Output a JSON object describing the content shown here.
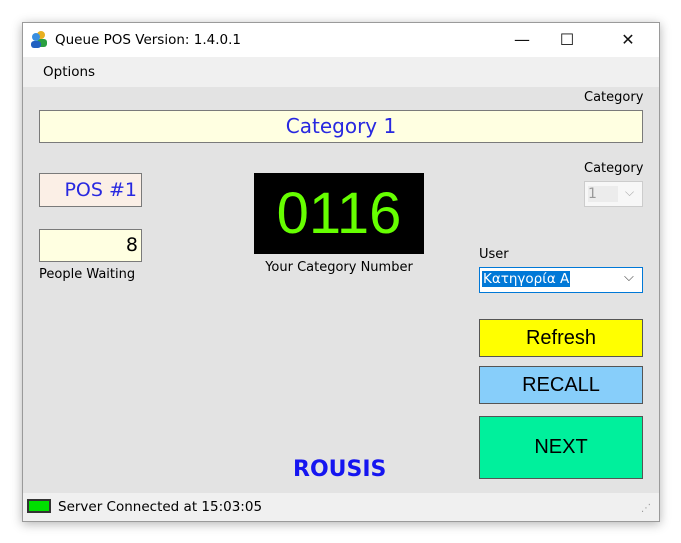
{
  "window": {
    "title": "Queue POS  Version: 1.4.0.1",
    "minimize": "—",
    "maximize": "☐",
    "close": "✕"
  },
  "menu": {
    "options": "Options"
  },
  "category_label": "Category",
  "category_banner": "Category 1",
  "pos_label": "POS #1",
  "people_waiting": {
    "value": "8",
    "label": "People Waiting"
  },
  "display": {
    "number": "0116",
    "label": "Your Category Number"
  },
  "category_select": {
    "label": "Category",
    "value": "1"
  },
  "user_select": {
    "label": "User",
    "value": "Κατηγορία Α"
  },
  "buttons": {
    "refresh": "Refresh",
    "recall": "RECALL",
    "next": "NEXT"
  },
  "logo": "ROUSIS",
  "status": {
    "text": "Server Connected at 15:03:05"
  },
  "colors": {
    "refresh": "#ffff00",
    "recall": "#87cefa",
    "next": "#00f09c",
    "display_text": "#66ff00",
    "banner_text": "#2828e0"
  }
}
